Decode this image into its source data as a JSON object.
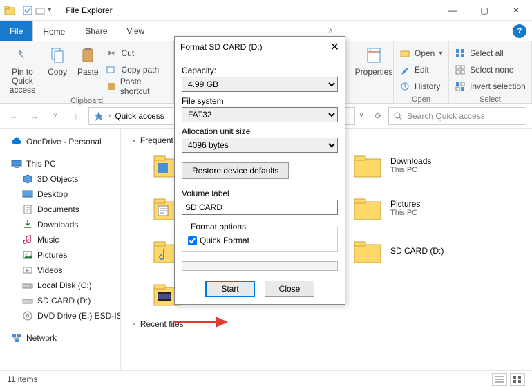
{
  "window": {
    "title": "File Explorer",
    "min": "—",
    "max": "▢",
    "close": "✕"
  },
  "tabs": {
    "file": "File",
    "home": "Home",
    "share": "Share",
    "view": "View"
  },
  "ribbon": {
    "clipboard": {
      "pin": "Pin to Quick access",
      "copy": "Copy",
      "paste": "Paste",
      "cut": "Cut",
      "copypath": "Copy path",
      "pasteshort": "Paste shortcut",
      "label": "Clipboard"
    },
    "properties": "Properties",
    "open": {
      "open": "Open",
      "edit": "Edit",
      "history": "History",
      "label": "Open"
    },
    "select": {
      "all": "Select all",
      "none": "Select none",
      "invert": "Invert selection",
      "label": "Select"
    }
  },
  "nav": {
    "breadcrumb": "Quick access",
    "refresh": "⟳",
    "search_placeholder": "Search Quick access"
  },
  "tree": {
    "onedrive": "OneDrive - Personal",
    "thispc": "This PC",
    "objects3d": "3D Objects",
    "desktop": "Desktop",
    "documents": "Documents",
    "downloads": "Downloads",
    "music": "Music",
    "pictures": "Pictures",
    "videos": "Videos",
    "localdisk": "Local Disk (C:)",
    "sdcard": "SD CARD (D:)",
    "dvd": "DVD Drive (E:) ESD-IS",
    "network": "Network"
  },
  "main": {
    "section_freq": "Frequent folders",
    "section_recent": "Recent files",
    "folders": [
      {
        "name": "Downloads",
        "sub": "This PC"
      },
      {
        "name": "Pictures",
        "sub": "This PC"
      },
      {
        "name": "SD CARD (D:)",
        "sub": ""
      },
      {
        "name": "",
        "sub": ""
      }
    ]
  },
  "status": {
    "items": "11 items"
  },
  "dialog": {
    "title": "Format SD CARD (D:)",
    "capacity_lbl": "Capacity:",
    "capacity_val": "4.99 GB",
    "fs_lbl": "File system",
    "fs_val": "FAT32",
    "alloc_lbl": "Allocation unit size",
    "alloc_val": "4096 bytes",
    "restore": "Restore device defaults",
    "vol_lbl": "Volume label",
    "vol_val": "SD CARD",
    "fmt_legend": "Format options",
    "quick": "Quick Format",
    "start": "Start",
    "close": "Close"
  }
}
